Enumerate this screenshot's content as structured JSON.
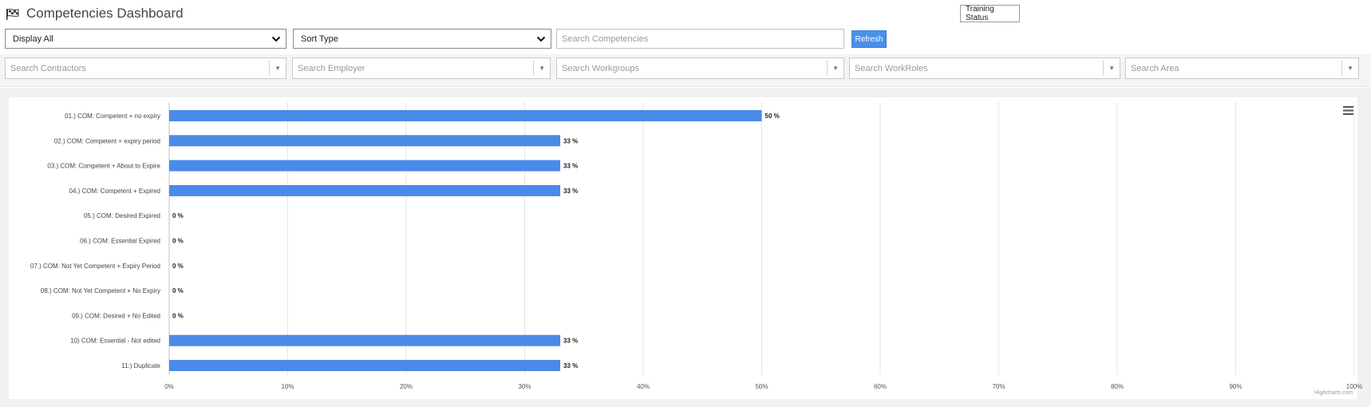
{
  "header": {
    "title": "Competencies Dashboard",
    "training_status_label": "Training Status"
  },
  "controls": {
    "display_select": "Display All",
    "sort_select": "Sort Type",
    "search_competencies_placeholder": "Search Competencies",
    "refresh_label": "Refresh"
  },
  "filters": {
    "contractors": "Search Contractors",
    "employer": "Search Employer",
    "workgroups": "Search Workgroups",
    "workroles": "Search WorkRoles",
    "area": "Search Area"
  },
  "chart_credit": "Highcharts.com",
  "chart_data": {
    "type": "bar",
    "orientation": "horizontal",
    "categories": [
      "01.) COM: Competent + no expiry",
      "02.) COM: Competent + expiry period",
      "03.) COM: Competent + About to Expire",
      "04.) COM: Competent + Expired",
      "05.) COM: Desired Expired",
      "06.) COM: Essential Expired",
      "07.) COM: Not Yet Competent + Expiry Period",
      "08.) COM: Not Yet Competent + No Expiry",
      "09.) COM: Desired + No Edited",
      "10) COM: Essential - Not edited",
      "11:) Duplicate"
    ],
    "values": [
      50,
      33,
      33,
      33,
      0,
      0,
      0,
      0,
      0,
      33,
      33
    ],
    "data_labels": [
      "50 %",
      "33 %",
      "33 %",
      "33 %",
      "0 %",
      "0 %",
      "0 %",
      "0 %",
      "0 %",
      "33 %",
      "33 %"
    ],
    "xlim": [
      0,
      100
    ],
    "ticks": [
      0,
      10,
      20,
      30,
      40,
      50,
      60,
      70,
      80,
      90,
      100
    ],
    "tick_labels": [
      "0%",
      "10%",
      "20%",
      "30%",
      "40%",
      "50%",
      "60%",
      "70%",
      "80%",
      "90%",
      "100%"
    ],
    "grid": true,
    "bar_color": "#4a8ae8"
  }
}
